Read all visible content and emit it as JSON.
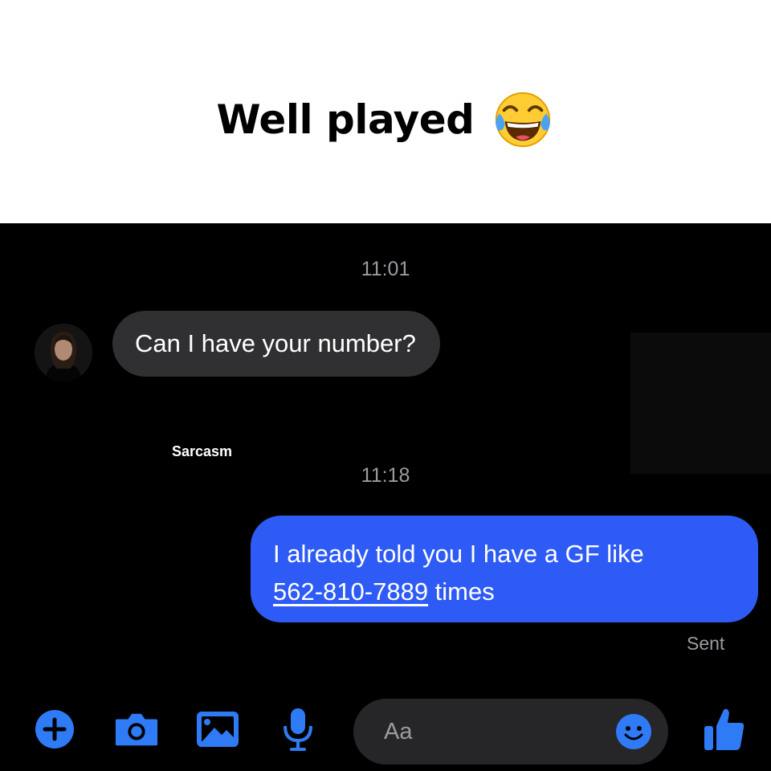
{
  "caption": {
    "text": "Well played",
    "emoji": "face-with-tears-of-joy"
  },
  "conversation": {
    "timestamps": [
      "11:01",
      "11:18"
    ],
    "incoming_message": "Can I have your number?",
    "watermark": "Sarcasm",
    "outgoing_message": {
      "text_before": "I already told you I have a GF like",
      "phone_link": "562-810-7889",
      "text_after": " times"
    },
    "status": "Sent"
  },
  "composer": {
    "placeholder": "Aa",
    "icons": [
      "plus-icon",
      "camera-icon",
      "image-icon",
      "microphone-icon",
      "smiley-icon",
      "thumbs-up-icon"
    ]
  },
  "colors": {
    "accent": "#2e5bf5",
    "icon_blue": "#2f7bf6",
    "incoming_bubble": "#303033",
    "background": "#000000",
    "muted_text": "#9b9ba1"
  }
}
